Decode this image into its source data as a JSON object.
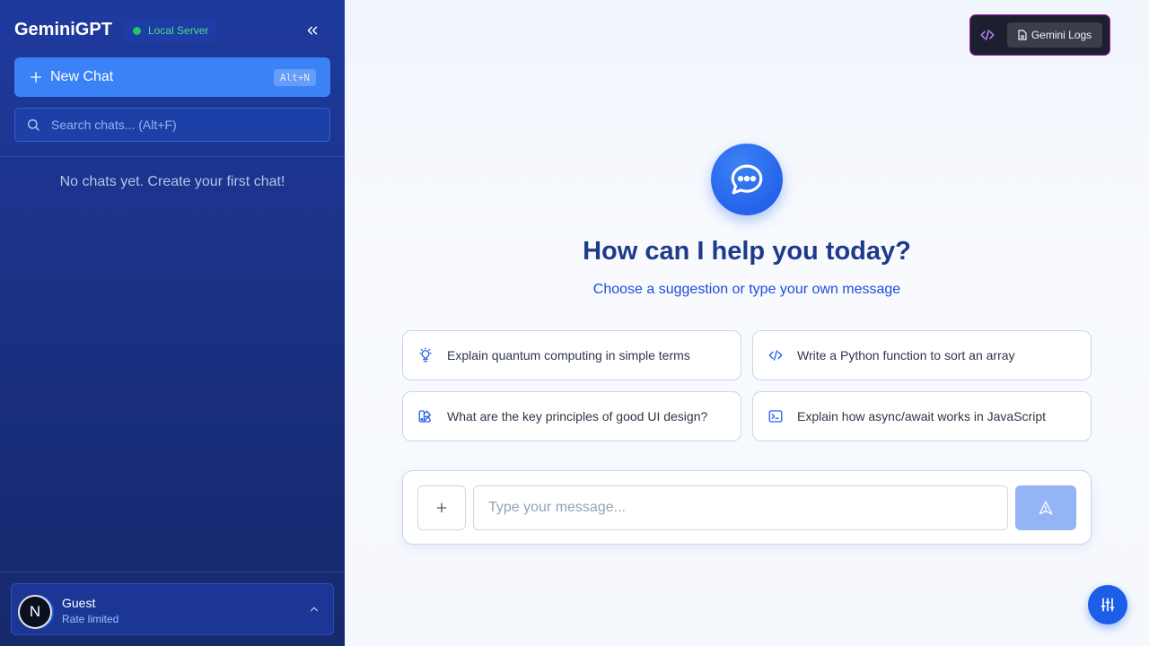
{
  "sidebar": {
    "app_title": "GeminiGPT",
    "server_status": "Local Server",
    "new_chat_label": "New Chat",
    "new_chat_shortcut": "Alt+N",
    "search_placeholder": "Search chats... (Alt+F)",
    "empty_message": "No chats yet. Create your first chat!",
    "user": {
      "avatar_letter": "N",
      "name": "Guest",
      "status": "Rate limited"
    }
  },
  "topbar": {
    "logs_label": "Gemini Logs"
  },
  "hero": {
    "title": "How can I help you today?",
    "subtitle": "Choose a suggestion or type your own message"
  },
  "suggestions": [
    {
      "icon": "lightbulb-icon",
      "text": "Explain quantum computing in simple terms"
    },
    {
      "icon": "code-icon",
      "text": "Write a Python function to sort an array"
    },
    {
      "icon": "palette-icon",
      "text": "What are the key principles of good UI design?"
    },
    {
      "icon": "terminal-icon",
      "text": "Explain how async/await works in JavaScript"
    }
  ],
  "composer": {
    "placeholder": "Type your message..."
  },
  "colors": {
    "sidebar_bg": "#1e3a9e",
    "accent": "#3b82f6",
    "server_online": "#22c55e",
    "title": "#1e3a8a"
  }
}
